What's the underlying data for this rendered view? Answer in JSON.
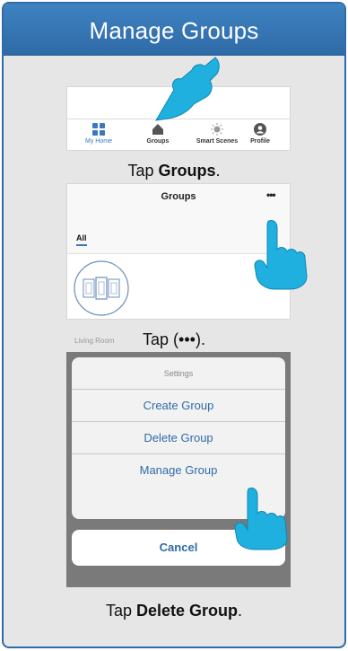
{
  "header": {
    "title": "Manage Groups"
  },
  "step1": {
    "tabs": [
      {
        "label": "My Home",
        "icon": "grid-icon",
        "active": true
      },
      {
        "label": "Groups",
        "icon": "house-icon",
        "active": false
      },
      {
        "label": "Smart Scenes",
        "icon": "sun-icon",
        "active": false
      },
      {
        "label": "Profile",
        "icon": "profile-icon",
        "active": false
      }
    ],
    "caption_prefix": "Tap ",
    "caption_bold": "Groups",
    "caption_suffix": "."
  },
  "step2": {
    "title": "Groups",
    "more": "•••",
    "filter_tab": "All",
    "room_label": "Living Room",
    "caption": "Tap (•••)."
  },
  "step3": {
    "sheet_title": "Settings",
    "items": [
      "Create Group",
      "Delete Group",
      "Manage Group"
    ],
    "cancel": "Cancel",
    "caption_prefix": "Tap ",
    "caption_bold": "Delete Group",
    "caption_suffix": "."
  },
  "colors": {
    "accent": "#2f6ba8",
    "banner": "#3a78c0",
    "panel_bg": "#e6e6e6",
    "hand": "#1fb0e0"
  }
}
